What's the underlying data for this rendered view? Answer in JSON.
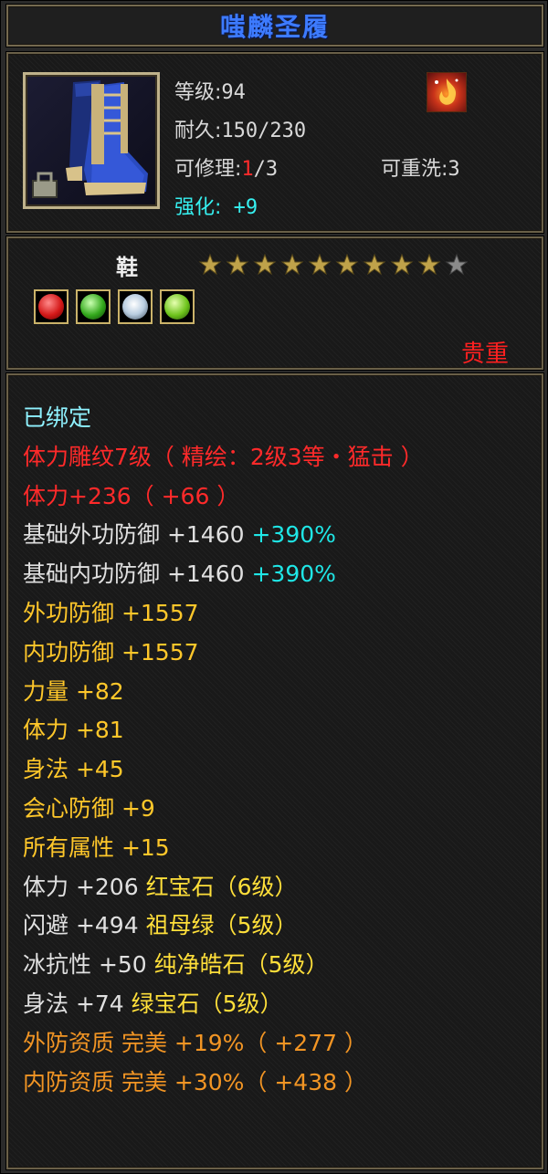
{
  "title": "嗤麟圣履",
  "colors": {
    "title": "#3d7bff",
    "frame": "#6a6048",
    "panel": "#191919"
  },
  "header": {
    "level_label": "等级:",
    "level_value": "94",
    "durability_label": "耐久:",
    "durability_value": "150/230",
    "repair_label": "可修理:",
    "repair_current": "1",
    "repair_max": "/3",
    "rewash_label": "可重洗:",
    "rewash_value": "3",
    "enhance_label": "强化:",
    "enhance_value": "+9",
    "item_icon": "boots-icon",
    "badge_icon": "fire-badge-icon"
  },
  "section2": {
    "type": "鞋",
    "stars_filled": 9,
    "stars_total": 10,
    "gems": [
      "red-gem-icon",
      "green-gem-icon",
      "white-gem-icon",
      "emerald-gem-icon"
    ],
    "rarity": "贵重"
  },
  "attributes": [
    {
      "parts": [
        {
          "t": "已绑定",
          "c": "c-cyan"
        }
      ]
    },
    {
      "parts": [
        {
          "t": "体力雕纹7级（ 精绘：2级3等・猛击 ）",
          "c": "c-red"
        }
      ]
    },
    {
      "parts": [
        {
          "t": "体力+236（ +66 ）",
          "c": "c-red"
        }
      ]
    },
    {
      "parts": [
        {
          "t": "基础外功防御 +1460 ",
          "c": "c-white"
        },
        {
          "t": "+390%",
          "c": "c-aqua"
        }
      ]
    },
    {
      "parts": [
        {
          "t": "基础内功防御 +1460 ",
          "c": "c-white"
        },
        {
          "t": "+390%",
          "c": "c-aqua"
        }
      ]
    },
    {
      "parts": [
        {
          "t": "外功防御 +1557",
          "c": "c-gold"
        }
      ]
    },
    {
      "parts": [
        {
          "t": "内功防御 +1557",
          "c": "c-gold"
        }
      ]
    },
    {
      "parts": [
        {
          "t": "力量 +82",
          "c": "c-gold"
        }
      ]
    },
    {
      "parts": [
        {
          "t": "体力 +81",
          "c": "c-gold"
        }
      ]
    },
    {
      "parts": [
        {
          "t": "身法 +45",
          "c": "c-gold"
        }
      ]
    },
    {
      "parts": [
        {
          "t": "会心防御 +9",
          "c": "c-gold"
        }
      ]
    },
    {
      "parts": [
        {
          "t": "所有属性 +15",
          "c": "c-gold"
        }
      ]
    },
    {
      "parts": [
        {
          "t": "体力 +206 ",
          "c": "c-white"
        },
        {
          "t": "红宝石（6级）",
          "c": "c-yellow"
        }
      ]
    },
    {
      "parts": [
        {
          "t": "闪避 +494 ",
          "c": "c-white"
        },
        {
          "t": "祖母绿（5级）",
          "c": "c-yellow"
        }
      ]
    },
    {
      "parts": [
        {
          "t": "冰抗性 +50 ",
          "c": "c-white"
        },
        {
          "t": "纯净皓石（5级）",
          "c": "c-yellow"
        }
      ]
    },
    {
      "parts": [
        {
          "t": "身法 +74 ",
          "c": "c-white"
        },
        {
          "t": "绿宝石（5级）",
          "c": "c-yellow"
        }
      ]
    },
    {
      "parts": [
        {
          "t": "外防资质 完美 +19%（ +277 ）",
          "c": "c-orange"
        }
      ]
    },
    {
      "parts": [
        {
          "t": "内防资质 完美 +30%（ +438 ）",
          "c": "c-orange"
        }
      ]
    }
  ]
}
